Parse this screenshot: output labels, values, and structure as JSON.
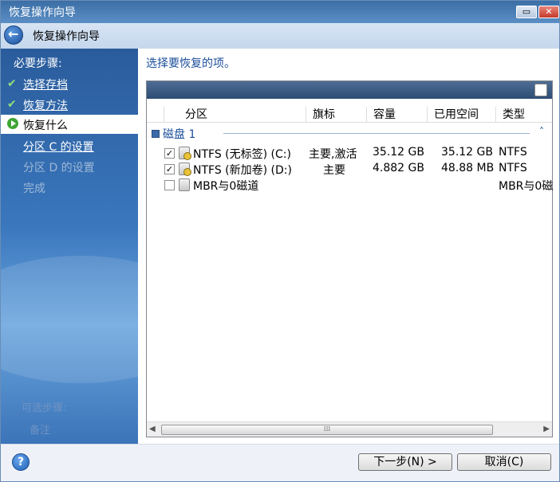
{
  "window": {
    "title": "恢复操作向导"
  },
  "nav": {
    "title": "恢复操作向导"
  },
  "sidebar": {
    "heading": "必要步骤:",
    "steps": [
      {
        "label": "选择存档",
        "state": "done"
      },
      {
        "label": "恢复方法",
        "state": "done"
      },
      {
        "label": "恢复什么",
        "state": "current"
      },
      {
        "label": "分区 C 的设置",
        "state": "link"
      },
      {
        "label": "分区 D 的设置",
        "state": "disabled"
      },
      {
        "label": "完成",
        "state": "disabled"
      }
    ],
    "extra_heading": "可选步骤:",
    "extra_item": "备注"
  },
  "main": {
    "heading": "选择要恢复的项。",
    "columns": [
      "分区",
      "旗标",
      "容量",
      "已用空间",
      "类型"
    ],
    "group": {
      "label": "磁盘 1"
    },
    "rows": [
      {
        "checked": true,
        "partition": "NTFS (无标签) (C:)",
        "flags": "主要,激活",
        "capacity": "35.12 GB",
        "used": "35.12 GB",
        "type": "NTFS"
      },
      {
        "checked": true,
        "partition": "NTFS (新加卷) (D:)",
        "flags": "主要",
        "capacity": "4.882 GB",
        "used": "48.88 MB",
        "type": "NTFS"
      },
      {
        "checked": false,
        "partition": "MBR与0磁道",
        "flags": "",
        "capacity": "",
        "used": "",
        "type": "MBR与0磁"
      }
    ]
  },
  "footer": {
    "next_label": "下一步(N) >",
    "cancel_label": "取消(C)"
  },
  "colors": {
    "accent": "#1b4e9a",
    "sidebar": "#3a77bd",
    "titlebar": "#3a6ea5"
  }
}
